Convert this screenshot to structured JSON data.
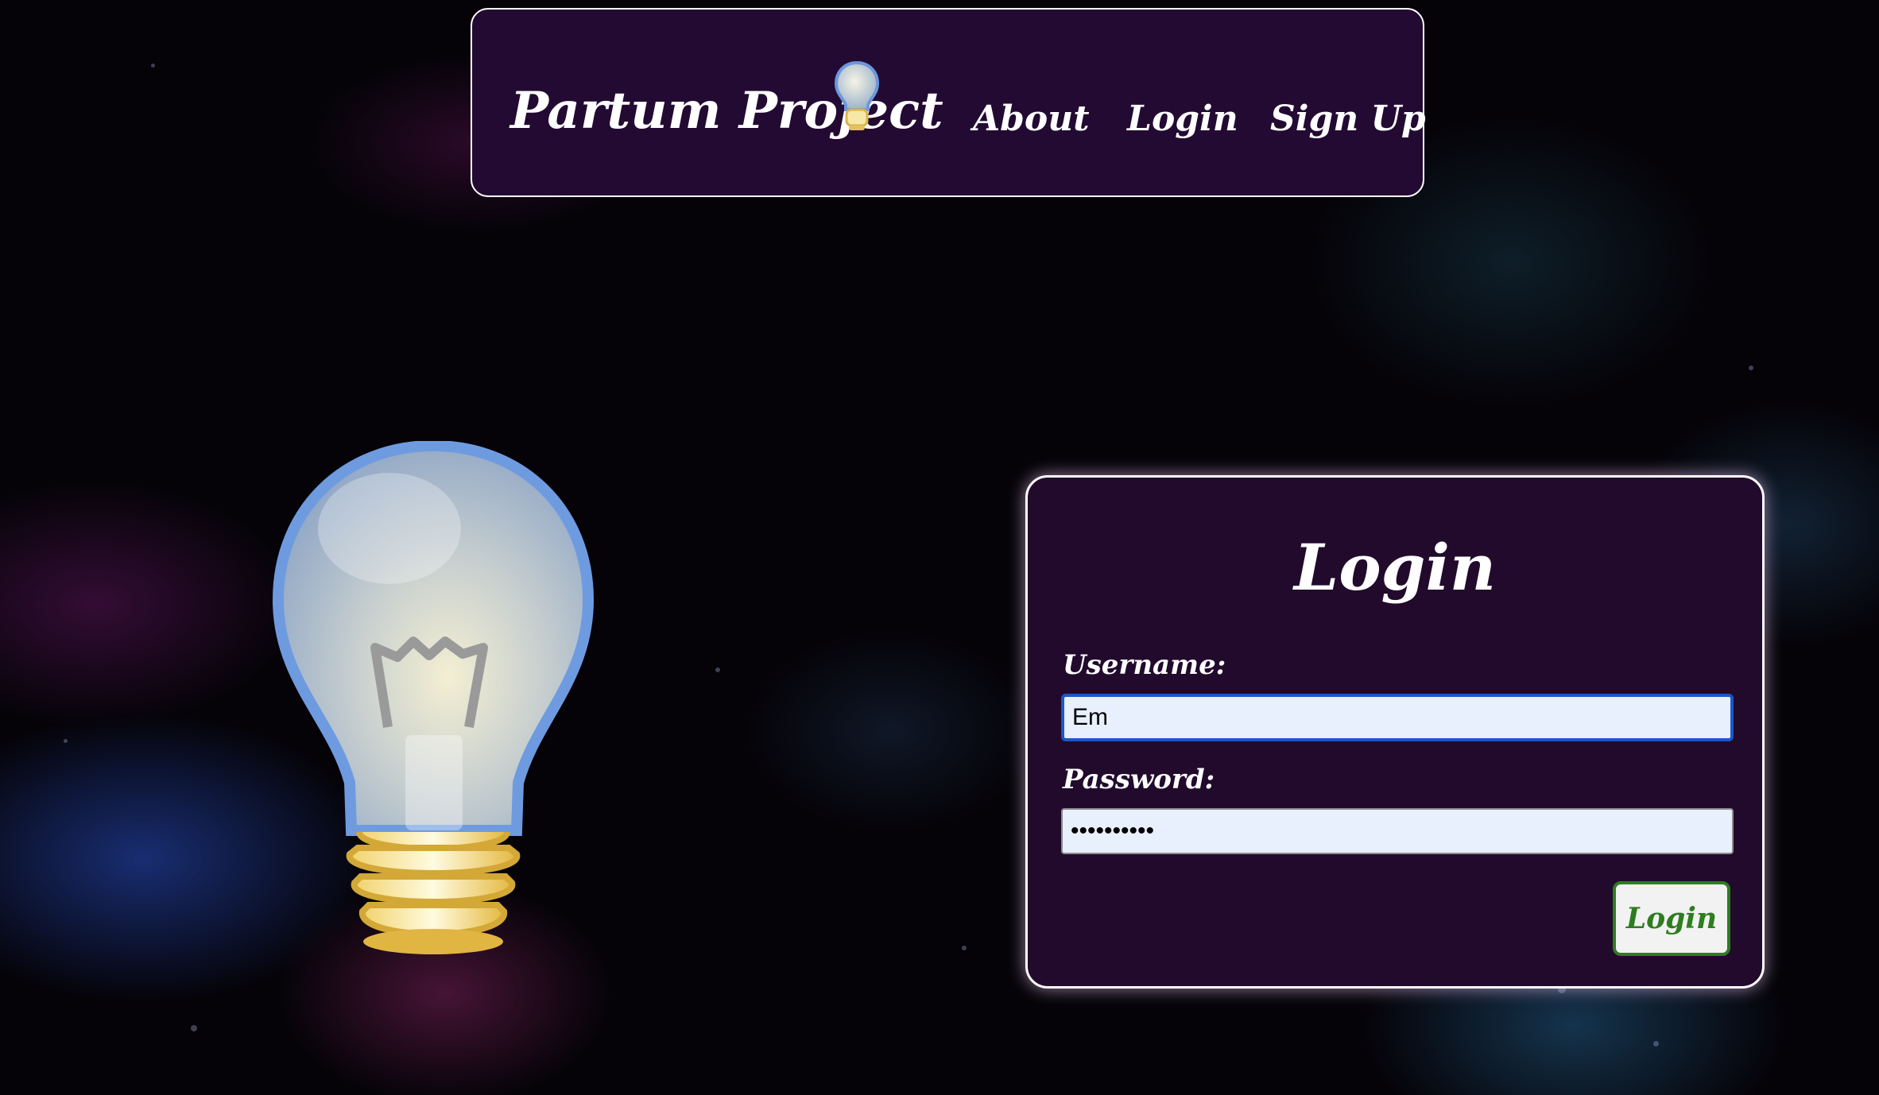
{
  "header": {
    "brand": "Partum Project",
    "nav": {
      "about": "About",
      "login": "Login",
      "signup": "Sign Up"
    }
  },
  "login_form": {
    "title": "Login",
    "username_label": "Username:",
    "username_value": "Em",
    "password_label": "Password:",
    "password_value": "••••••••••",
    "submit_label": "Login"
  },
  "colors": {
    "header_bg": "#230a33",
    "card_bg": "#220a2d",
    "input_bg": "#e8f0fe",
    "focus_border": "#1a57c9",
    "button_green": "#2e7d1f"
  },
  "icons": {
    "brand": "lightbulb-icon",
    "hero": "lightbulb-icon"
  }
}
